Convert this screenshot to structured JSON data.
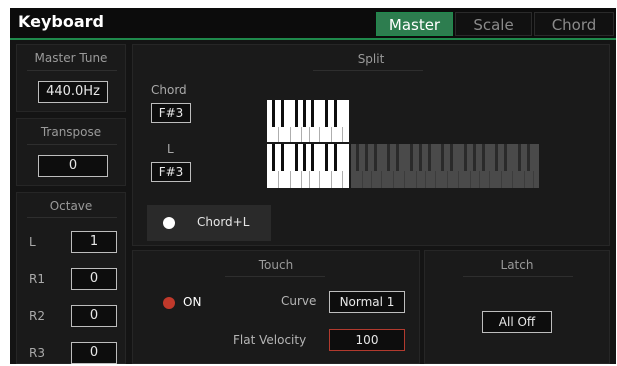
{
  "header": {
    "title": "Keyboard",
    "tabs": [
      {
        "label": "Master",
        "active": true
      },
      {
        "label": "Scale",
        "active": false
      },
      {
        "label": "Chord",
        "active": false
      }
    ]
  },
  "master_tune": {
    "label": "Master Tune",
    "value": "440.0Hz"
  },
  "transpose": {
    "label": "Transpose",
    "value": "0"
  },
  "octave": {
    "label": "Octave",
    "rows": [
      {
        "name": "L",
        "value": "1"
      },
      {
        "name": "R1",
        "value": "0"
      },
      {
        "name": "R2",
        "value": "0"
      },
      {
        "name": "R3",
        "value": "0"
      }
    ]
  },
  "split": {
    "label": "Split",
    "chord_label": "Chord",
    "chord_value": "F#3",
    "l_label": "L",
    "l_value": "F#3",
    "mode_label": "Chord+L"
  },
  "touch": {
    "label": "Touch",
    "state": "ON",
    "curve_label": "Curve",
    "curve_value": "Normal 1",
    "flat_velocity_label": "Flat Velocity",
    "flat_velocity_value": "100"
  },
  "latch": {
    "label": "Latch",
    "button": "All Off"
  },
  "colors": {
    "accent": "#2d7d4f",
    "on_indicator": "#c0392b",
    "highlight_border": "#b23a2e"
  }
}
